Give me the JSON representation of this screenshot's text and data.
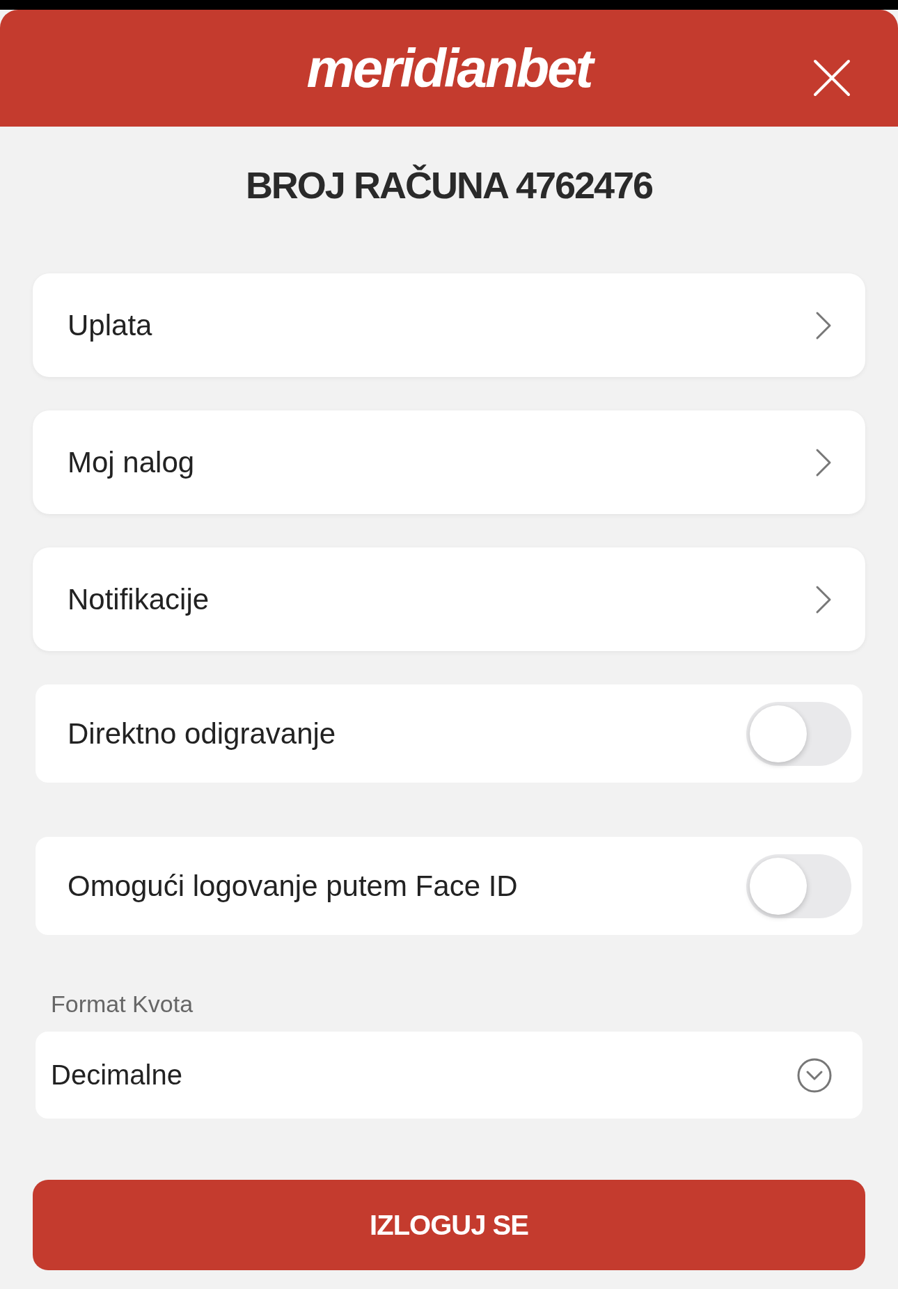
{
  "header": {
    "logo": "meridianbet"
  },
  "title": "BROJ RAČUNA 4762476",
  "items": [
    {
      "kind": "link",
      "label": "Uplata"
    },
    {
      "kind": "link",
      "label": "Moj nalog"
    },
    {
      "kind": "link",
      "label": "Notifikacije"
    },
    {
      "kind": "toggle",
      "label": "Direktno odigravanje",
      "on": false
    },
    {
      "kind": "toggle",
      "label": "Omogući logovanje putem Face ID",
      "on": false
    }
  ],
  "odds_format": {
    "label": "Format Kvota",
    "value": "Decimalne"
  },
  "logout_button": "IZLOGUJ SE"
}
